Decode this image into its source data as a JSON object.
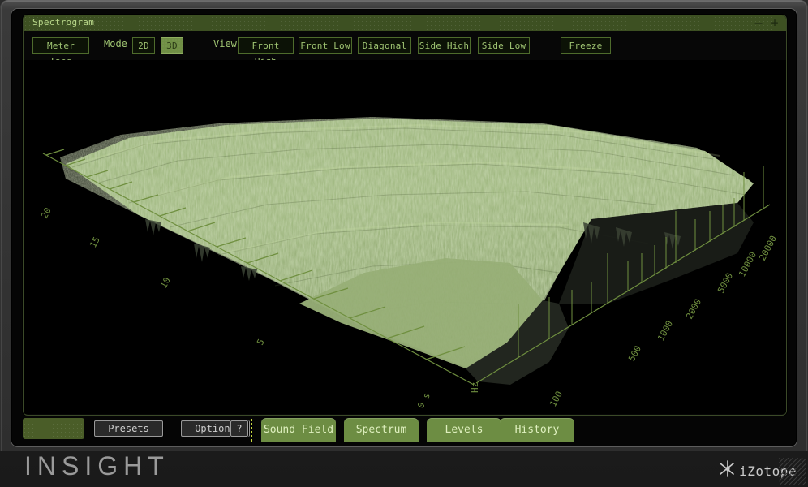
{
  "window": {
    "title": "Spectrogram",
    "minimize_icon": "minimize-icon",
    "minimize_glyph": "–",
    "maximize_icon": "maximize-icon",
    "maximize_glyph": "+"
  },
  "toolbar": {
    "meter_taps_label": "Meter Taps",
    "mode_label": "Mode",
    "mode_options": [
      "2D",
      "3D"
    ],
    "mode_2d": "2D",
    "mode_3d": "3D",
    "mode_selected": "3D",
    "view_label": "View",
    "view_options": [
      "Front High",
      "Front Low",
      "Diagonal",
      "Side High",
      "Side Low"
    ],
    "view_front_high": "Front High",
    "view_front_low": "Front Low",
    "view_diagonal": "Diagonal",
    "view_side_high": "Side High",
    "view_side_low": "Side Low",
    "freeze_label": "Freeze"
  },
  "chart_data": {
    "type": "heatmap",
    "title": "Spectrogram",
    "render": "3D surface",
    "xlabel": "Hz",
    "ylabel": "s",
    "origin_label": "0 s",
    "freq_axis": {
      "label": "Hz",
      "scale": "log",
      "ticks": [
        100,
        500,
        1000,
        2000,
        5000,
        10000,
        20000
      ],
      "tick_labels": [
        "100",
        "500",
        "1000",
        "2000",
        "5000",
        "10000",
        "20000"
      ],
      "range": [
        20,
        24000
      ]
    },
    "time_axis": {
      "label": "s",
      "scale": "linear",
      "ticks": [
        0,
        5,
        10,
        15,
        20
      ],
      "tick_labels": [
        "0 s",
        "5",
        "10",
        "15",
        "20"
      ],
      "range": [
        0,
        22
      ]
    },
    "amplitude": {
      "encoding": "surface height + brightness",
      "surface_color": "#8da86a",
      "shadow_color": "#4a513b",
      "background": "#000000"
    },
    "grid": false,
    "legend": "none"
  },
  "bottom": {
    "presets_label": "Presets",
    "options_label": "Options",
    "help_label": "?",
    "tabs": [
      {
        "label": "Sound Field"
      },
      {
        "label": "Spectrum"
      },
      {
        "label": "Levels"
      },
      {
        "label": "History"
      }
    ]
  },
  "footer": {
    "product": "INSIGHT",
    "vendor": "iZotope",
    "vendor_mark_icon": "izotope-star-icon",
    "resize_grip_icon": "resize-grip-icon"
  },
  "colors": {
    "accent_green": "#8da86a",
    "title_olive": "#3d5022",
    "tab_green": "#6d8d43",
    "axis_green": "#6f8f3f",
    "text_green": "#9fc472"
  }
}
